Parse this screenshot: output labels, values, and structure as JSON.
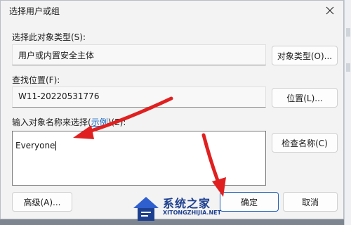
{
  "dialog": {
    "title": "选择用户或组",
    "close_icon": "close-icon"
  },
  "object_type": {
    "label": "选择此对象类型(S):",
    "value": "用户或内置安全主体",
    "button": "对象类型(O)..."
  },
  "location": {
    "label": "查找位置(F):",
    "value": "W11-20220531776",
    "button": "位置(L)..."
  },
  "names": {
    "label_prefix": "输入对象名称来选择(",
    "label_link": "示例",
    "label_suffix": ")(E):",
    "value": "Everyone",
    "check_button": "检查名称(C)"
  },
  "footer": {
    "advanced_button": "高级(A)...",
    "ok_button": "确定",
    "cancel_button": "取消"
  },
  "watermark": {
    "title": "系统之家",
    "subtitle": "XITONGZHIJIA.NET"
  },
  "colors": {
    "arrow": "#e02020",
    "link": "#1565c0",
    "primary_border": "#1f5fb4"
  }
}
